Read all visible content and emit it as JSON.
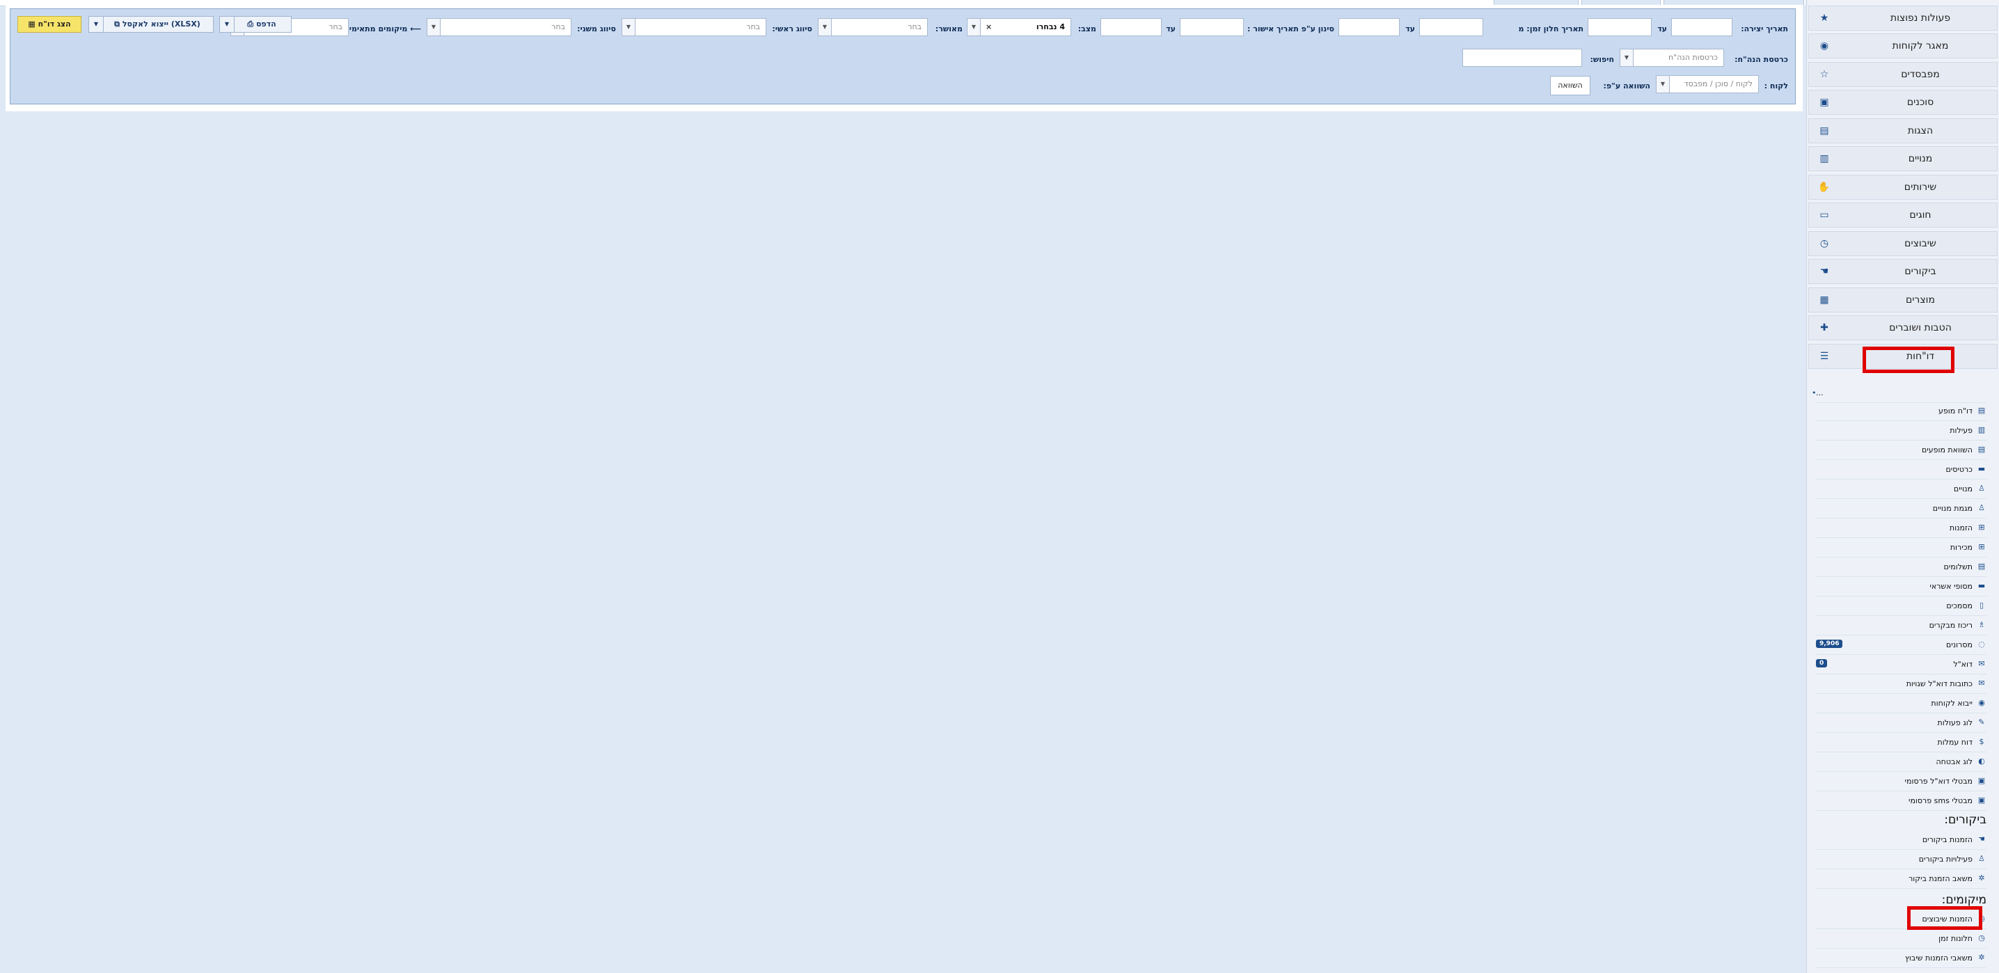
{
  "filters": {
    "creation_date_label": "תאריך יצירה:",
    "until_label": "עד",
    "time_window_date_label": "תאריך חלון זמן: מ",
    "until2_label": "עד",
    "approval_filter_label": "סינון ע\"פ תאריך אישור :",
    "until3_label": "עד",
    "status_label": "מצב:",
    "status_value": "4 נבחרו",
    "status_clear": "×",
    "approved_label": "מאושר:",
    "approved_value": "בחר",
    "main_category_label": "סיווג ראשי:",
    "main_category_value": "בחר",
    "sub_category_label": "סיווג משני:",
    "sub_category_value": "בחר",
    "locations_label": "⟵ מיקומים מתאימים:",
    "locations_value": "בחר",
    "receipt_card_label": "כרטסת הנה\"ח:",
    "receipt_card_placeholder": "כרטסות הנה\"ח",
    "search_label": "חיפוש:",
    "customer_label": "לקוח :",
    "customer_placeholder": "לקוח / סוכן / מפבסד",
    "compare_label": "השוואה ע\"פ:",
    "compare_button": "השוואה"
  },
  "toolbar": {
    "show_report": "הצג דו\"ח",
    "export_excel": "ייצוא לאקסל (XLSX)",
    "print": "הדפס"
  },
  "sidebar": {
    "items": [
      {
        "label": "פעולות נפוצות",
        "icon": "star-icon"
      },
      {
        "label": "מאגר לקוחות",
        "icon": "user-circle-icon"
      },
      {
        "label": "מפבסדים",
        "icon": "star-outline-icon"
      },
      {
        "label": "סוכנים",
        "icon": "briefcase-icon"
      },
      {
        "label": "הצגות",
        "icon": "film-icon"
      },
      {
        "label": "מנויים",
        "icon": "id-card-icon"
      },
      {
        "label": "שירותים",
        "icon": "handshake-icon"
      },
      {
        "label": "חוגים",
        "icon": "chalkboard-icon"
      },
      {
        "label": "שיבוצים",
        "icon": "clock-icon"
      },
      {
        "label": "ביקורים",
        "icon": "hand-icon"
      },
      {
        "label": "מוצרים",
        "icon": "boxes-icon"
      },
      {
        "label": "הטבות ושוברים",
        "icon": "gift-icon"
      },
      {
        "label": "דו\"חות",
        "icon": "table-icon"
      }
    ],
    "ellipsis": "...",
    "reports": [
      {
        "label": "דו\"ח מופע",
        "icon": "film-icon"
      },
      {
        "label": "פעילות",
        "icon": "chart-icon"
      },
      {
        "label": "השוואת מופעים",
        "icon": "film-icon"
      },
      {
        "label": "כרטיסים",
        "icon": "ticket-icon"
      },
      {
        "label": "מנויים",
        "icon": "person-icon"
      },
      {
        "label": "מגמת מנויים",
        "icon": "person-icon"
      },
      {
        "label": "הזמנות",
        "icon": "cart-icon"
      },
      {
        "label": "מכירות",
        "icon": "cart-icon"
      },
      {
        "label": "תשלומים",
        "icon": "receipt-icon"
      },
      {
        "label": "מסופי אשראי",
        "icon": "credit-card-icon"
      },
      {
        "label": "מסמכים",
        "icon": "document-icon"
      },
      {
        "label": "ריכוז מבקרים",
        "icon": "walking-icon"
      },
      {
        "label": "מסרונים",
        "icon": "comment-icon",
        "badge": "9,906"
      },
      {
        "label": "דוא\"ל",
        "icon": "envelope-icon",
        "badge": "0"
      },
      {
        "label": "כתובות דוא\"ל שגויות",
        "icon": "envelope-icon"
      },
      {
        "label": "ייבוא לקוחות",
        "icon": "user-circle-icon"
      },
      {
        "label": "לוג פעולות",
        "icon": "wrench-icon"
      },
      {
        "label": "דוח עמלות",
        "icon": "dollar-icon"
      },
      {
        "label": "לוג אבטחה",
        "icon": "shield-icon"
      },
      {
        "label": "מבטלי דוא\"ל פרסומי",
        "icon": "user-box-icon"
      },
      {
        "label": "מבטלי sms פרסומי",
        "icon": "user-box-icon"
      }
    ],
    "visits_heading": "ביקורים:",
    "visits": [
      {
        "label": "הזמנות ביקורים",
        "icon": "hand-icon"
      },
      {
        "label": "פעילויות ביקורים",
        "icon": "person-icon"
      },
      {
        "label": "משאב הזמנת ביקור",
        "icon": "resource-icon"
      }
    ],
    "placements_heading": "מיקומים:",
    "placements": [
      {
        "label": "הזמנות שיבוצים",
        "icon": "clock-icon"
      },
      {
        "label": "חלונות זמן",
        "icon": "clock-icon"
      },
      {
        "label": "משאבי הזמנות שיבוץ",
        "icon": "resource-icon"
      }
    ]
  },
  "colors": {
    "accent": "#1d4e8c",
    "highlight": "#e00000",
    "panel": "#c9daf0",
    "yellow_button": "#f6e36a"
  }
}
